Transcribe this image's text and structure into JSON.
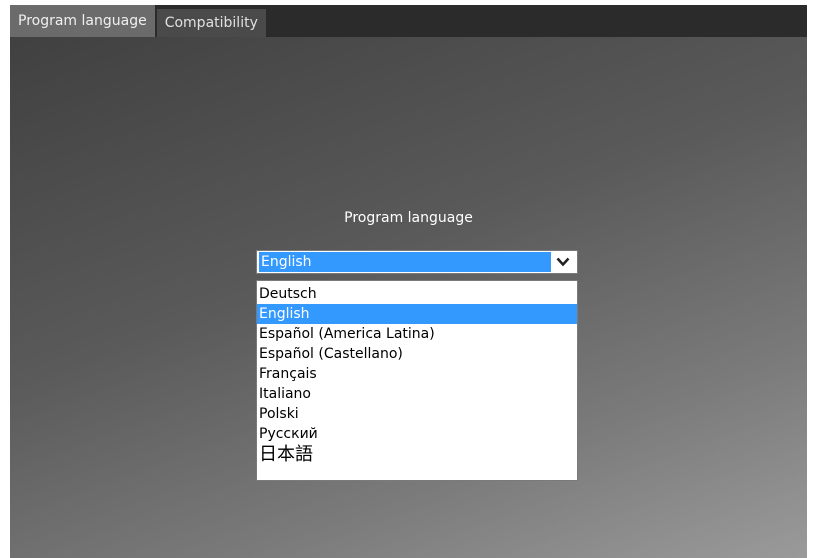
{
  "tabs": [
    {
      "label": "Program language",
      "active": true
    },
    {
      "label": "Compatibility",
      "active": false
    }
  ],
  "section_label": "Program language",
  "language_select": {
    "value": "English",
    "options": [
      "Deutsch",
      "English",
      "Español (America Latina)",
      "Español (Castellano)",
      "Français",
      "Italiano",
      "Polski",
      "Русский",
      "日本語"
    ],
    "selected_index": 1
  },
  "colors": {
    "highlight": "#3399ff",
    "tab_active": "#6b6b6b",
    "tab_inactive": "#4a4a4a"
  },
  "icons": {
    "select_arrow": "chevron-down-icon"
  }
}
